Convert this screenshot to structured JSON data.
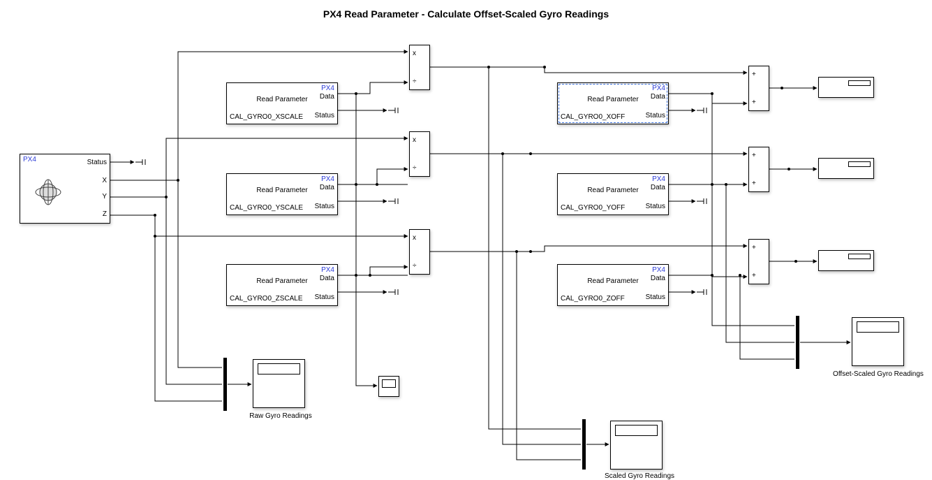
{
  "title": "PX4 Read Parameter - Calculate Offset-Scaled Gyro Readings",
  "px4_tag": "PX4",
  "gyro": {
    "port_status": "Status",
    "port_x": "X",
    "port_y": "Y",
    "port_z": "Z"
  },
  "read_param_label": "Read Parameter",
  "port_data": "Data",
  "port_status": "Status",
  "params_scale": {
    "x": "CAL_GYRO0_XSCALE",
    "y": "CAL_GYRO0_YSCALE",
    "z": "CAL_GYRO0_ZSCALE"
  },
  "params_off": {
    "x": "CAL_GYRO0_XOFF",
    "y": "CAL_GYRO0_YOFF",
    "z": "CAL_GYRO0_ZOFF"
  },
  "op_mul": {
    "top": "x",
    "bot": "÷"
  },
  "op_add": {
    "top": "+",
    "bot": "+"
  },
  "captions": {
    "raw": "Raw Gyro Readings",
    "scaled": "Scaled Gyro Readings",
    "offset": "Offset-Scaled Gyro Readings"
  }
}
